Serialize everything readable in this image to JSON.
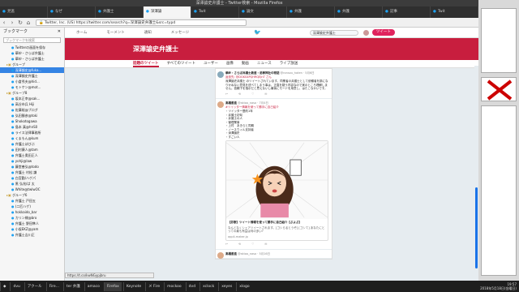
{
  "window": {
    "title": "深澤諭史弁護士 - Twitter検索 - Mozilla Firefox"
  },
  "tabs": [
    {
      "label": "見逃",
      "active": false
    },
    {
      "label": "なぜ",
      "active": false
    },
    {
      "label": "弁護士",
      "active": false
    },
    {
      "label": "深澤諭",
      "active": true
    },
    {
      "label": "Twit",
      "active": false
    },
    {
      "label": "論文",
      "active": false
    },
    {
      "label": "弁護",
      "active": false
    },
    {
      "label": "弁護",
      "active": false
    },
    {
      "label": "記事",
      "active": false
    },
    {
      "label": "Twit",
      "active": false
    }
  ],
  "nav": {
    "url": "https://twitter.com/search?q=深澤諭史弁護士&src=typd",
    "secure_label": "Twitter, Inc. (US)"
  },
  "sidebar": {
    "title": "ブックマーク",
    "search_placeholder": "ブックマークを検索",
    "items": [
      {
        "label": "Twitterの画面を保存",
        "kind": "page",
        "selected": false
      },
      {
        "label": "華紗・さらば弁護士",
        "kind": "page",
        "selected": false
      },
      {
        "label": "華紗・さらば弁護士",
        "kind": "page",
        "selected": false
      },
      {
        "label": "グループ",
        "kind": "folder",
        "selected": false
      },
      {
        "label": "深澤諭史@fuka...",
        "kind": "page",
        "selected": true
      },
      {
        "label": "深澤諭史弁護士",
        "kind": "page",
        "selected": false
      },
      {
        "label": "小倉秀夫@hid...",
        "kind": "page",
        "selected": false
      },
      {
        "label": "モトケン@mot...",
        "kind": "page",
        "selected": false
      },
      {
        "label": "グループ8",
        "kind": "folder",
        "selected": false
      },
      {
        "label": "坂本正幸@sak...",
        "kind": "page",
        "selected": false
      },
      {
        "label": "高谷市兵 Hiji",
        "kind": "page",
        "selected": false
      },
      {
        "label": "佐藤裕@ブログ",
        "kind": "page",
        "selected": false
      },
      {
        "label": "弘田勝彦@toki",
        "kind": "page",
        "selected": false
      },
      {
        "label": "Shokotogawa",
        "kind": "page",
        "selected": false
      },
      {
        "label": "島本 真@hnS0",
        "kind": "page",
        "selected": false
      },
      {
        "label": "ライス法律事務所",
        "kind": "page",
        "selected": false
      },
      {
        "label": "くまもん@kum",
        "kind": "page",
        "selected": false
      },
      {
        "label": "弁護士ぼびぶ",
        "kind": "page",
        "selected": false
      },
      {
        "label": "田村康人@tam",
        "kind": "page",
        "selected": false
      },
      {
        "label": "弁護士奥田正人",
        "kind": "page",
        "selected": false
      },
      {
        "label": "yohji@law",
        "kind": "page",
        "selected": false
      },
      {
        "label": "藤堂善弘@todo",
        "kind": "page",
        "selected": false
      },
      {
        "label": "弁護士 村松 謙",
        "kind": "page",
        "selected": false
      },
      {
        "label": "白宮勤/ハゲパ",
        "kind": "page",
        "selected": false
      },
      {
        "label": "黒 弘兆/ぱ 太",
        "kind": "page",
        "selected": false
      },
      {
        "label": "White@twlwOC",
        "kind": "page",
        "selected": false
      },
      {
        "label": "グループ6",
        "kind": "folder",
        "selected": false
      },
      {
        "label": "弁護士 戸田五",
        "kind": "page",
        "selected": false
      },
      {
        "label": "(二匹ハゲ)",
        "kind": "page",
        "selected": false
      },
      {
        "label": "hokkaido_bar",
        "kind": "page",
        "selected": false
      },
      {
        "label": "カリン様@bro",
        "kind": "page",
        "selected": false
      },
      {
        "label": "弁護士 野田隼人",
        "kind": "page",
        "selected": false
      },
      {
        "label": "小坂EKZ@yam",
        "kind": "page",
        "selected": false
      },
      {
        "label": "弁護士吉川正",
        "kind": "page",
        "selected": false
      }
    ]
  },
  "twitter": {
    "top_nav": [
      "ホーム",
      "モーメント",
      "通知",
      "メッセージ"
    ],
    "search_value": "深澤諭史弁護士",
    "tweet_button": "ツイート",
    "banner": "深澤諭史弁護士",
    "search_tabs": [
      {
        "label": "話題のツイート",
        "active": true
      },
      {
        "label": "すべてのツイート",
        "active": false
      },
      {
        "label": "ユーザー",
        "active": false
      },
      {
        "label": "画像",
        "active": false
      },
      {
        "label": "動画",
        "active": false
      },
      {
        "label": "ニュース",
        "active": false
      },
      {
        "label": "ライブ放送",
        "active": false
      }
    ],
    "tweets": [
      {
        "name": "華紗・さらば弁護士鉄道・泥棒神社の物語",
        "handle": "@ronsou_hoten · 5月6日",
        "reply": "返信先: @DGKS4PQHRQEJnT さん",
        "body": "深澤諭史弁護士 のツイートされています。同業者の弁護士として依頼者を損になりかねない意見を述べてしまう事は、正直を疑う内容なので実のところ理解しません。信頼下を指示だと思えないし最後にモードを用意し、はたこなかいです。",
        "actions": "↩ ⟲ ♡ ✉"
      },
      {
        "name": "髙橋善直",
        "handle": "@akioo_naso · 7月4日",
        "reply": "#ツイッター情報を使って勝手に自己紹介",
        "body": "・ツイッター歴約1年\n・弁護士初旬\n・弁護士の人\n・管理業事\n・上村　あきらと同期\n・ノースウィル支持者\n・深澤諭史\n・すごい人",
        "card_title": "【診断】ツイート情報を使って勝手に自己紹介【ぷよぷ】",
        "card_desc": "なんとなくシェアツイートされます。[ゴシらるとうぞ] [ゴシて] あなたにとっての最も有益は何の多い?",
        "card_url": "appli-maker.jp",
        "actions": "↩ ⟲ ♡ ✉"
      },
      {
        "name": "髙橋善直",
        "handle": "@akioo_naso · 5月16日",
        "reply": "",
        "body": "",
        "actions": ""
      }
    ]
  },
  "status_url": "https://t.co/kwNGypjbru",
  "taskbar": {
    "items": [
      "dvu",
      "アクール",
      "Fire...",
      "ter 弁護",
      "amaco",
      "Firefox",
      "Keynote",
      "メ Fire",
      "mockoo",
      "dvd",
      "xclock",
      "xeyes",
      "xlogo"
    ],
    "clock_time": "19:57",
    "clock_date": "2018年5月18日(金曜日)"
  },
  "colors": {
    "accent": "#c81e3e",
    "twitter_blue": "#1da1f2",
    "tweet_button": "#e0245e"
  }
}
